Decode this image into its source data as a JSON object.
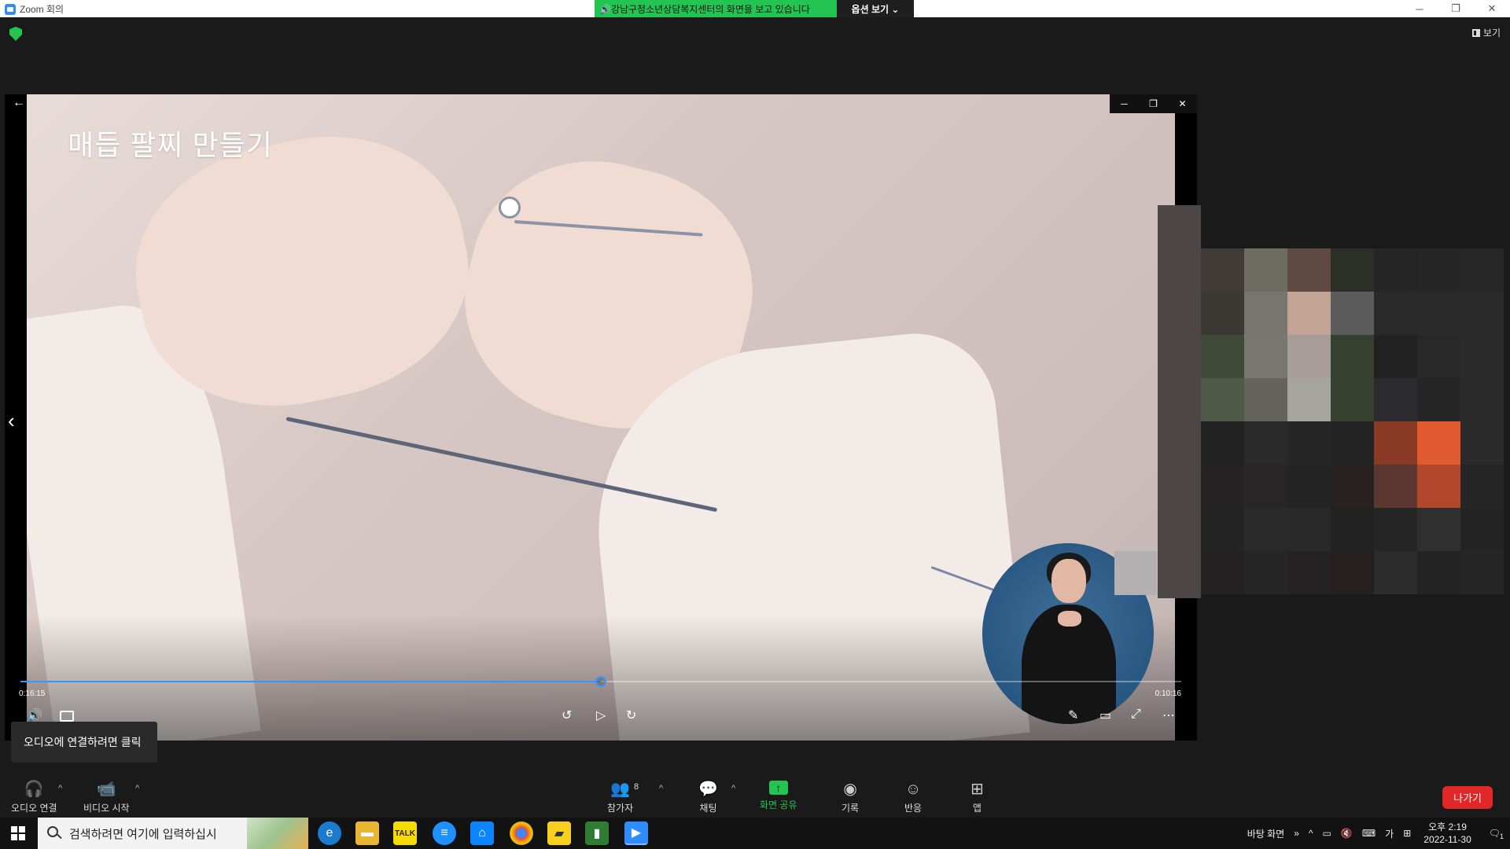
{
  "window": {
    "title": "Zoom 회의",
    "share_banner": "🔊강남구청소년상담복지센터의 화면을 보고 있습니다",
    "view_options": "옵션 보기 ⌄",
    "view_button": "보기"
  },
  "video": {
    "title": "매듭 팔찌 만들기",
    "current_time": "0:16:15",
    "total_time": "0:10:16",
    "progress": 0.5
  },
  "tooltip": "오디오에 연결하려면 클릭",
  "toolbar": {
    "audio_label": "오디오 연결",
    "video_label": "비디오 시작",
    "participants_label": "참가자",
    "participants_count": "8",
    "chat_label": "채팅",
    "share_label": "화면 공유",
    "record_label": "기록",
    "reactions_label": "반응",
    "apps_label": "앱",
    "leave_label": "나가기"
  },
  "taskbar": {
    "search_placeholder": "검색하려면 여기에 입력하십시",
    "desktop_label": "바탕 화면",
    "ime": "가",
    "time": "오후 2:19",
    "date": "2022-11-30",
    "notification_count": "1"
  },
  "colors": {
    "green": "#23c552",
    "blue": "#3a95ff",
    "red": "#e02828"
  },
  "pixel_colors": [
    "#403b36",
    "#6c6c62",
    "#5e4a43",
    "#2c2f25",
    "#252525",
    "#262626",
    "#272727",
    "#3c3935",
    "#787570",
    "#c2a394",
    "#5c5c5c",
    "#2a2a2a",
    "#2b2b2b",
    "#2a2a2a",
    "#3f4a38",
    "#7a7671",
    "#a89c98",
    "#35402e",
    "#222222",
    "#282828",
    "#2b2b2b",
    "#4f5a48",
    "#66625e",
    "#a5a49d",
    "#35402f",
    "#2c2c2e",
    "#262626",
    "#2a2a2a",
    "#222222",
    "#2a2a2a",
    "#262626",
    "#232323",
    "#8a3a24",
    "#e15a2f",
    "#2a2a2a",
    "#272223",
    "#2a2627",
    "#232323",
    "#272122",
    "#5c3631",
    "#b2472d",
    "#262626",
    "#242424",
    "#2a2a2a",
    "#292929",
    "#222222",
    "#252525",
    "#2f2f2f",
    "#242424",
    "#252122",
    "#262626",
    "#242222",
    "#251f20",
    "#2c2c2c",
    "#232323",
    "#262626"
  ]
}
